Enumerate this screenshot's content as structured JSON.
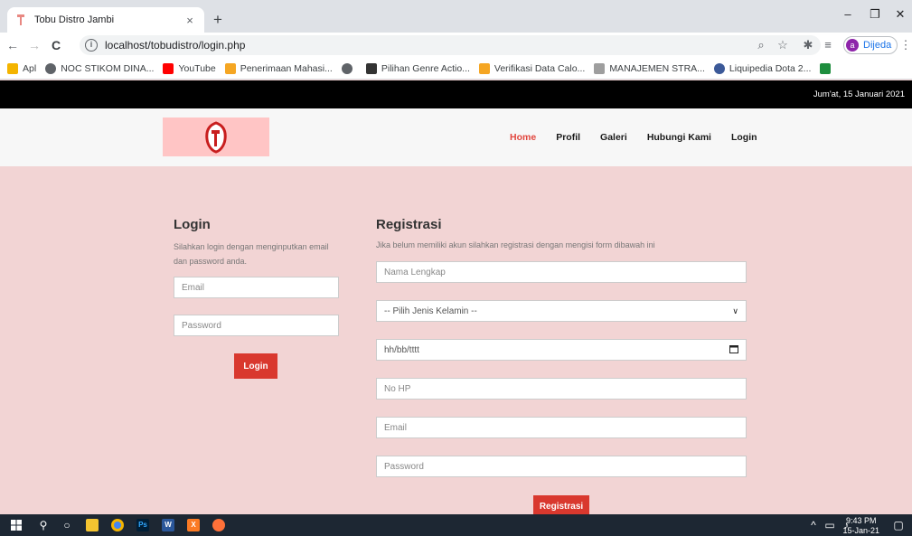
{
  "browser": {
    "tab_title": "Tobu Distro Jambi",
    "tab_close": "×",
    "new_tab": "+",
    "url": "localhost/tobudistro/login.php",
    "profile_initial": "a",
    "profile_name": "Dijeda",
    "bookmarks": [
      {
        "label": "Apl",
        "icon": "apps-grid-icon",
        "color": "#f4b400"
      },
      {
        "label": "NOC STIKOM DINA...",
        "icon": "globe-icon",
        "color": "#5f6368"
      },
      {
        "label": "YouTube",
        "icon": "youtube-icon",
        "color": "#ff0000"
      },
      {
        "label": "Penerimaan Mahasi...",
        "icon": "bookmark-icon",
        "color": "#f5a623"
      },
      {
        "label": "",
        "icon": "globe-icon",
        "color": "#5f6368"
      },
      {
        "label": "Pilihan Genre Actio...",
        "icon": "bookmark-icon",
        "color": "#333333"
      },
      {
        "label": "Verifikasi Data Calo...",
        "icon": "bookmark-icon",
        "color": "#f5a623"
      },
      {
        "label": "MANAJEMEN STRA...",
        "icon": "bookmark-icon",
        "color": "#9e9e9e"
      },
      {
        "label": "Liquipedia Dota 2...",
        "icon": "liquipedia-icon",
        "color": "#3b5998"
      },
      {
        "label": "",
        "icon": "bookmark-icon",
        "color": "#1e8e3e"
      }
    ]
  },
  "page": {
    "date": "Jum'at, 15 Januari 2021",
    "nav": [
      "Home",
      "Profil",
      "Galeri",
      "Hubungi Kami",
      "Login"
    ],
    "login": {
      "title": "Login",
      "description": "Silahkan login dengan menginputkan email dan password anda.",
      "email_placeholder": "Email",
      "password_placeholder": "Password",
      "button": "Login"
    },
    "register": {
      "title": "Registrasi",
      "description": "Jika belum memiliki akun silahkan registrasi dengan mengisi form dibawah ini",
      "name_placeholder": "Nama Lengkap",
      "gender_selected": "-- Pilih Jenis Kelamin --",
      "date_placeholder": "hh/bb/tttt",
      "phone_placeholder": "No HP",
      "email_placeholder": "Email",
      "password_placeholder": "Password",
      "button": "Registrasi"
    }
  },
  "taskbar": {
    "time": "9:43 PM",
    "date": "15-Jan-21",
    "apps": [
      "windows-start-icon",
      "search-icon",
      "cortana-icon",
      "file-explorer-icon",
      "chrome-icon",
      "photoshop-icon",
      "word-icon",
      "xampp-icon",
      "firefox-icon"
    ]
  },
  "colors": {
    "accent": "#d9382e",
    "nav_active": "#e2473f",
    "page_bg": "#f2d4d4"
  }
}
